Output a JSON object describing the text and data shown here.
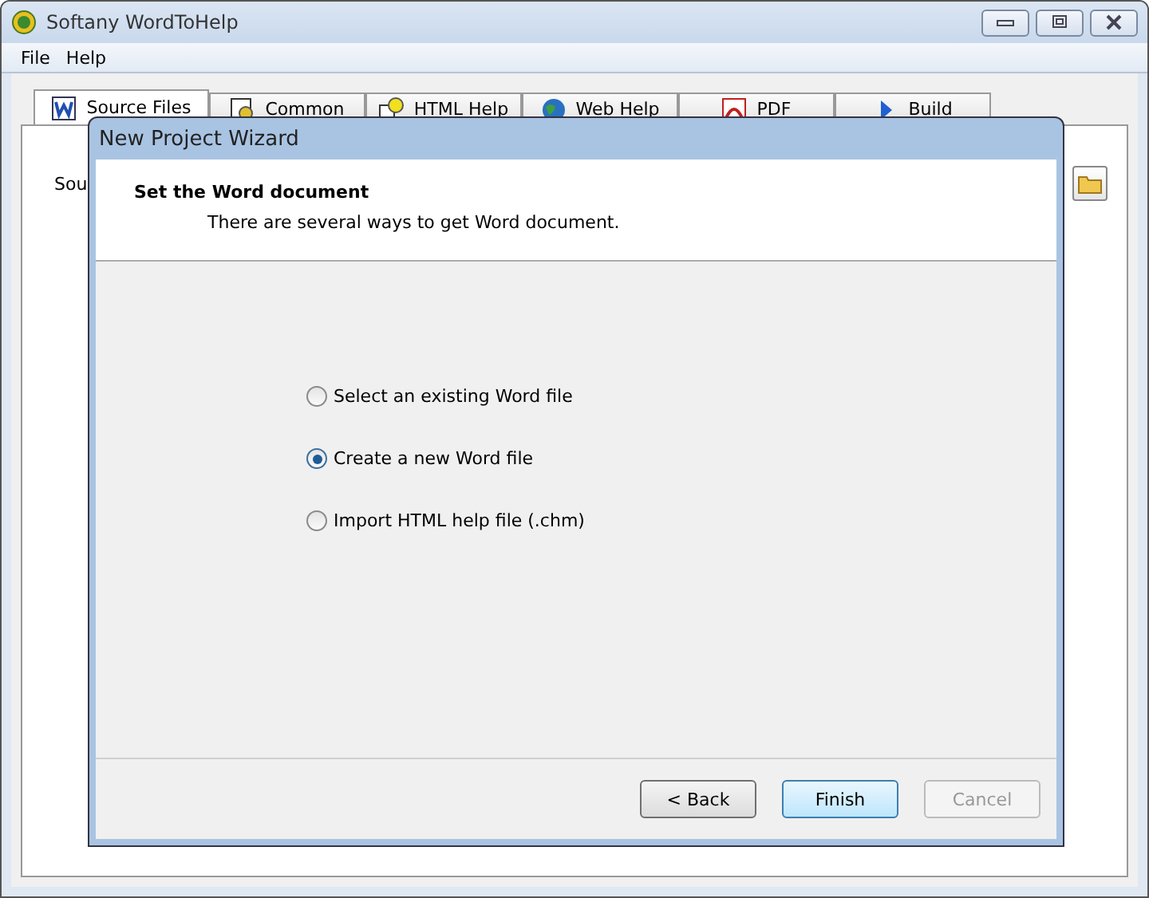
{
  "window": {
    "title": "Softany WordToHelp"
  },
  "menu": [
    "File",
    "Help"
  ],
  "tabs": [
    {
      "label": "Source Files",
      "selected": true
    },
    {
      "label": "Common",
      "selected": false
    },
    {
      "label": "HTML Help",
      "selected": false
    },
    {
      "label": "Web Help",
      "selected": false
    },
    {
      "label": "PDF",
      "selected": false
    },
    {
      "label": "Build",
      "selected": false
    }
  ],
  "panel": {
    "label": "Sou"
  },
  "dialog": {
    "title": "New Project Wizard",
    "heading": "Set the Word document",
    "subtitle": "There are several ways to get Word document.",
    "options": [
      {
        "label": "Select an existing Word file",
        "selected": false
      },
      {
        "label": "Create a new Word file",
        "selected": true
      },
      {
        "label": "Import HTML help file (.chm)",
        "selected": false
      }
    ],
    "buttons": [
      {
        "label": "< Back",
        "default": false,
        "disabled": false
      },
      {
        "label": "Finish",
        "default": true,
        "disabled": false
      },
      {
        "label": "Cancel",
        "default": false,
        "disabled": true
      }
    ]
  }
}
